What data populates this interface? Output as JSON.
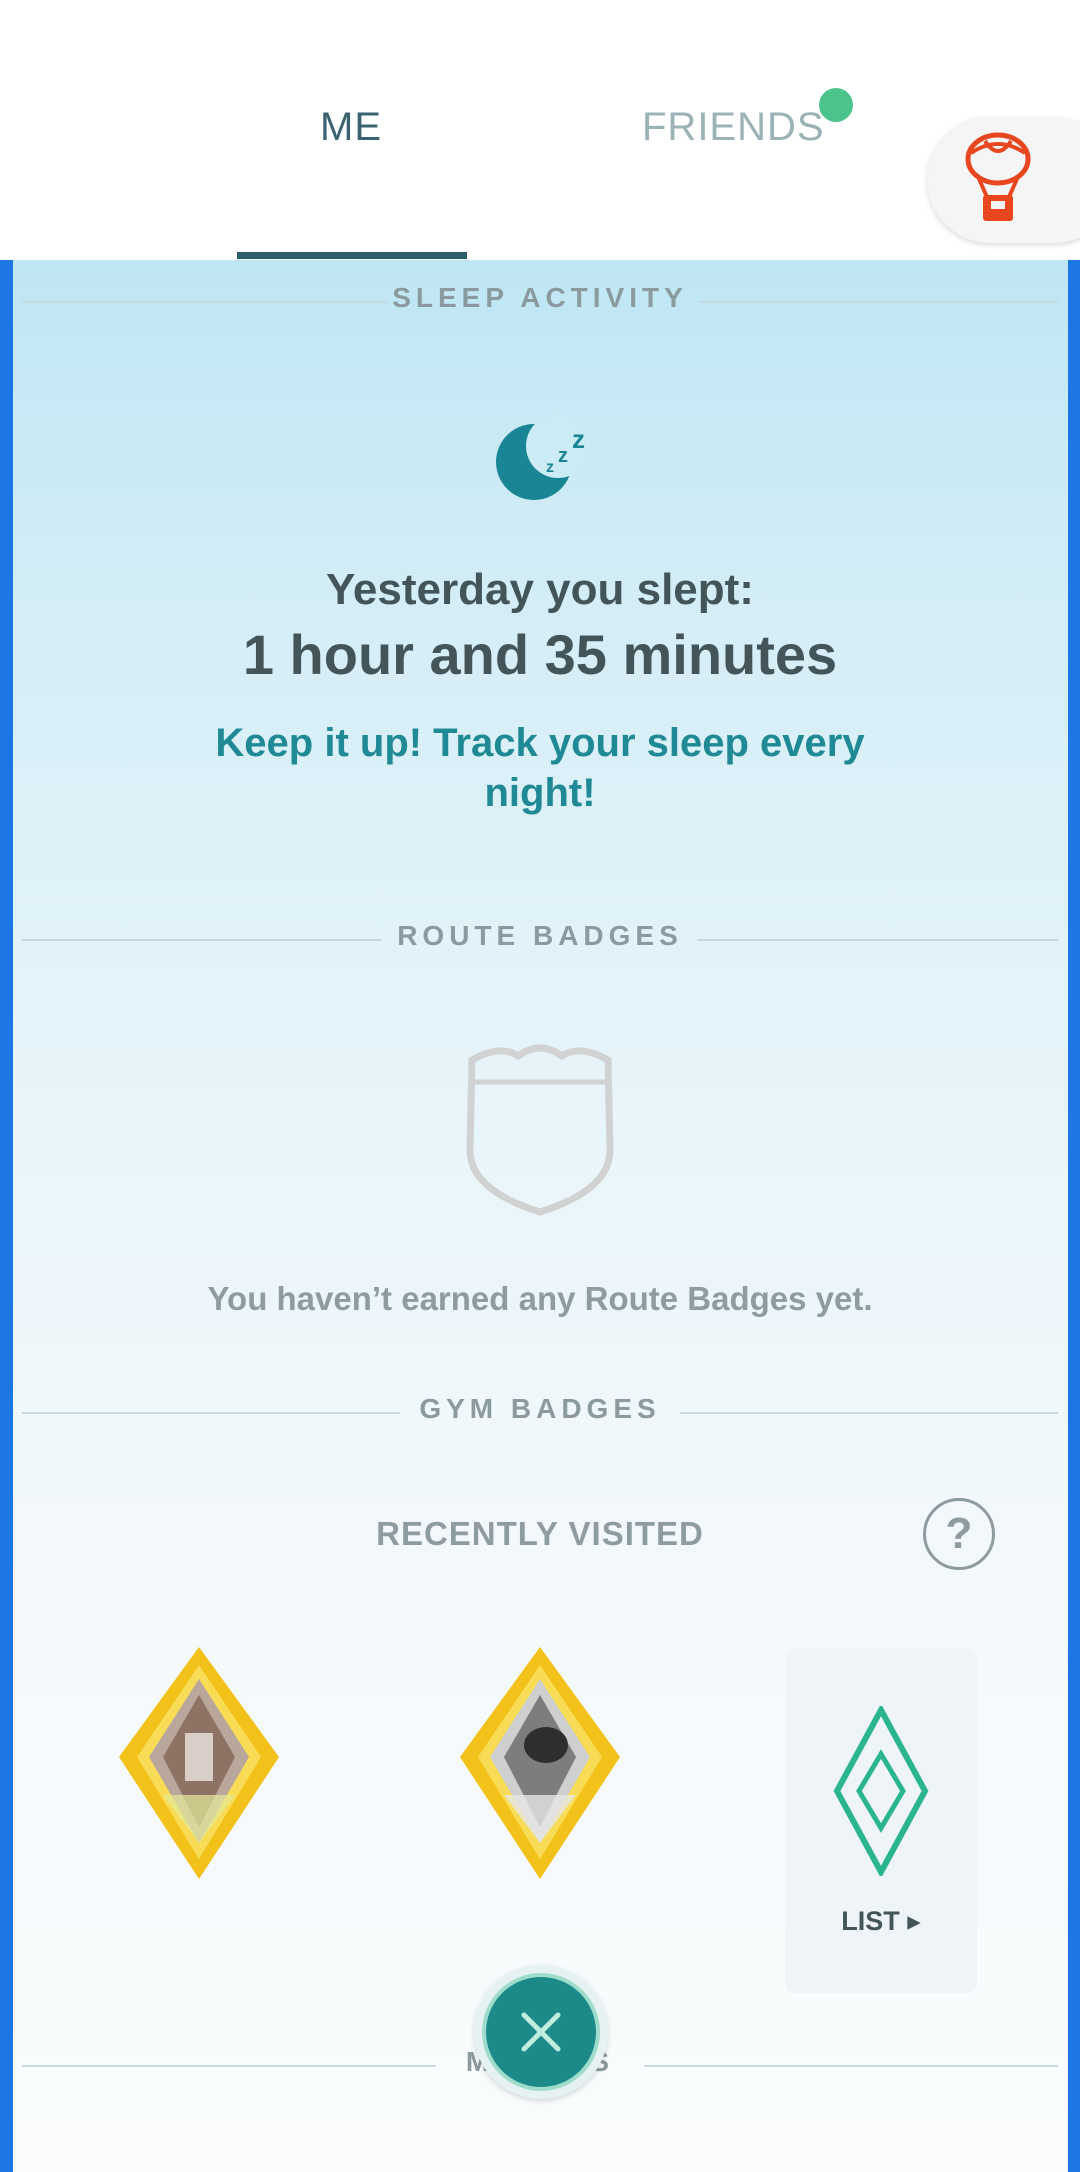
{
  "tabs": {
    "me_label": "ME",
    "friends_label": "FRIENDS",
    "friends_notification": true
  },
  "header_button": {
    "icon": "balloon-icon"
  },
  "sleep": {
    "section_title": "SLEEP ACTIVITY",
    "icon": "moon-sleep-icon",
    "label": "Yesterday you slept:",
    "value": "1 hour and 35 minutes",
    "message": "Keep it up! Track your sleep every night!"
  },
  "route_badges": {
    "section_title": "ROUTE BADGES",
    "icon": "route-shield-icon",
    "empty_message": "You haven’t earned any Route Badges yet."
  },
  "gym_badges": {
    "section_title": "GYM BADGES",
    "recently_visited_label": "RECENTLY VISITED",
    "help_label": "?",
    "badges": [
      {
        "icon": "gold-gym-badge-icon",
        "tier": "gold"
      },
      {
        "icon": "gold-gym-badge-icon",
        "tier": "gold"
      }
    ],
    "list_label": "LIST ▸",
    "list_icon": "diamond-outline-icon"
  },
  "medals": {
    "section_title": "MEDALS"
  },
  "close_button": {
    "icon": "close-icon"
  },
  "colors": {
    "accent_teal": "#1f8a96",
    "tab_active": "#2b5d6f",
    "notification": "#4cc38a",
    "frame_blue": "#1c77e4",
    "gold": "#f0c419"
  }
}
